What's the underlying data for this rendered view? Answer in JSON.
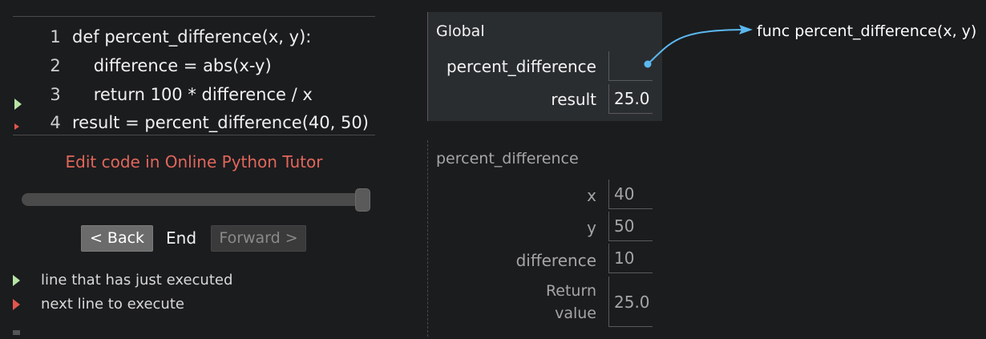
{
  "code": {
    "lines": [
      {
        "num": "1",
        "text": "def percent_difference(x, y):"
      },
      {
        "num": "2",
        "text": "    difference = abs(x-y)"
      },
      {
        "num": "3",
        "text": "    return 100 * difference / x"
      },
      {
        "num": "4",
        "text": "result = percent_difference(40, 50)"
      }
    ],
    "just_executed_line": 4,
    "next_line": 4
  },
  "edit_link": "Edit code in Online Python Tutor",
  "slider": {
    "position_fraction": 1.0
  },
  "navigation": {
    "back_label": "< Back",
    "step_label": "End",
    "forward_label": "Forward >"
  },
  "legend": {
    "executed": "line that has just executed",
    "next": "next line to execute"
  },
  "colors": {
    "executed_arrow": "#b7e4a5",
    "next_arrow": "#e2564c",
    "link": "#e2665b",
    "pointer": "#5bb8f0"
  },
  "global_frame": {
    "title": "Global",
    "vars": [
      {
        "name": "percent_difference",
        "value": ""
      },
      {
        "name": "result",
        "value": "25.0"
      }
    ]
  },
  "function_frame": {
    "title": "percent_difference",
    "vars": [
      {
        "name": "x",
        "value": "40"
      },
      {
        "name": "y",
        "value": "50"
      },
      {
        "name": "difference",
        "value": "10"
      }
    ],
    "return_label_line1": "Return",
    "return_label_line2": "value",
    "return_value": "25.0"
  },
  "heap": {
    "function_object": "func percent_difference(x, y)"
  }
}
